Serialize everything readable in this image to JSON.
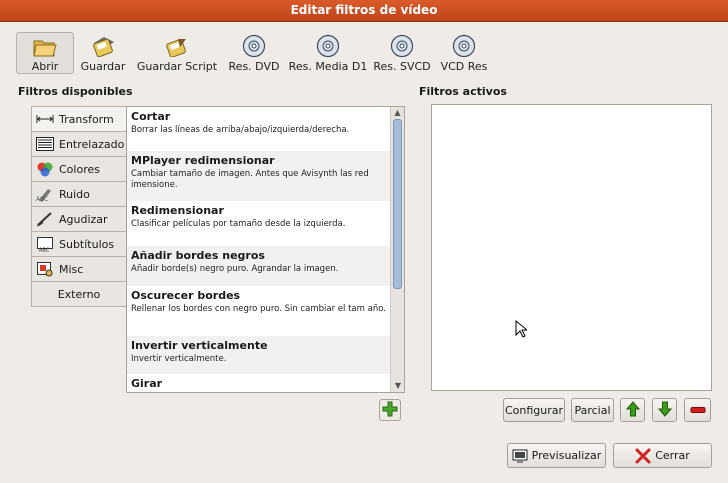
{
  "window": {
    "title": "Editar filtros de vídeo"
  },
  "toolbar": {
    "items": [
      {
        "label": "Abrir",
        "icon": "folder-open-icon"
      },
      {
        "label": "Guardar",
        "icon": "save-icon"
      },
      {
        "label": "Guardar Script",
        "icon": "save-script-icon"
      },
      {
        "label": "Res. DVD",
        "icon": "disc-icon"
      },
      {
        "label": "Res. Media D1",
        "icon": "disc-icon"
      },
      {
        "label": "Res. SVCD",
        "icon": "disc-icon"
      },
      {
        "label": "VCD Res",
        "icon": "disc-icon"
      }
    ]
  },
  "available": {
    "title": "Filtros disponibles",
    "tabs": [
      {
        "label": "Transform",
        "icon": "transform-icon"
      },
      {
        "label": "Entrelazado",
        "icon": "interlace-icon"
      },
      {
        "label": "Colores",
        "icon": "colors-icon"
      },
      {
        "label": "Ruido",
        "icon": "noise-icon"
      },
      {
        "label": "Agudizar",
        "icon": "sharpen-icon"
      },
      {
        "label": "Subtítulos",
        "icon": "subtitles-icon"
      },
      {
        "label": "Misc",
        "icon": "misc-icon"
      },
      {
        "label": "Externo"
      }
    ],
    "filters": [
      {
        "name": "Cortar",
        "desc": "Borrar las líneas de arriba/abajo/izquierda/derecha."
      },
      {
        "name": "MPlayer redimensionar",
        "desc": "Cambiar tamaño de imagen. Antes que Avisynth las red imensione."
      },
      {
        "name": "Redimensionar",
        "desc": "Clasificar películas por tamaño desde la izquierda."
      },
      {
        "name": "Añadir bordes negros",
        "desc": "Añadir borde(s) negro puro. Agrandar la imagen."
      },
      {
        "name": "Oscurecer bordes",
        "desc": "Rellenar los bordes con negro puro. Sin cambiar el tam año."
      },
      {
        "name": "Invertir verticalmente",
        "desc": "Invertir verticalmente."
      },
      {
        "name": "Girar",
        "desc": ""
      }
    ]
  },
  "active": {
    "title": "Filtros activos"
  },
  "buttons": {
    "configure": "Configurar",
    "partial": "Parcial",
    "preview": "Previsualizar",
    "close": "Cerrar"
  },
  "colors": {
    "titlebar": "#d0502a",
    "move_arrow": "#3c9a1c",
    "remove": "#d22020"
  }
}
